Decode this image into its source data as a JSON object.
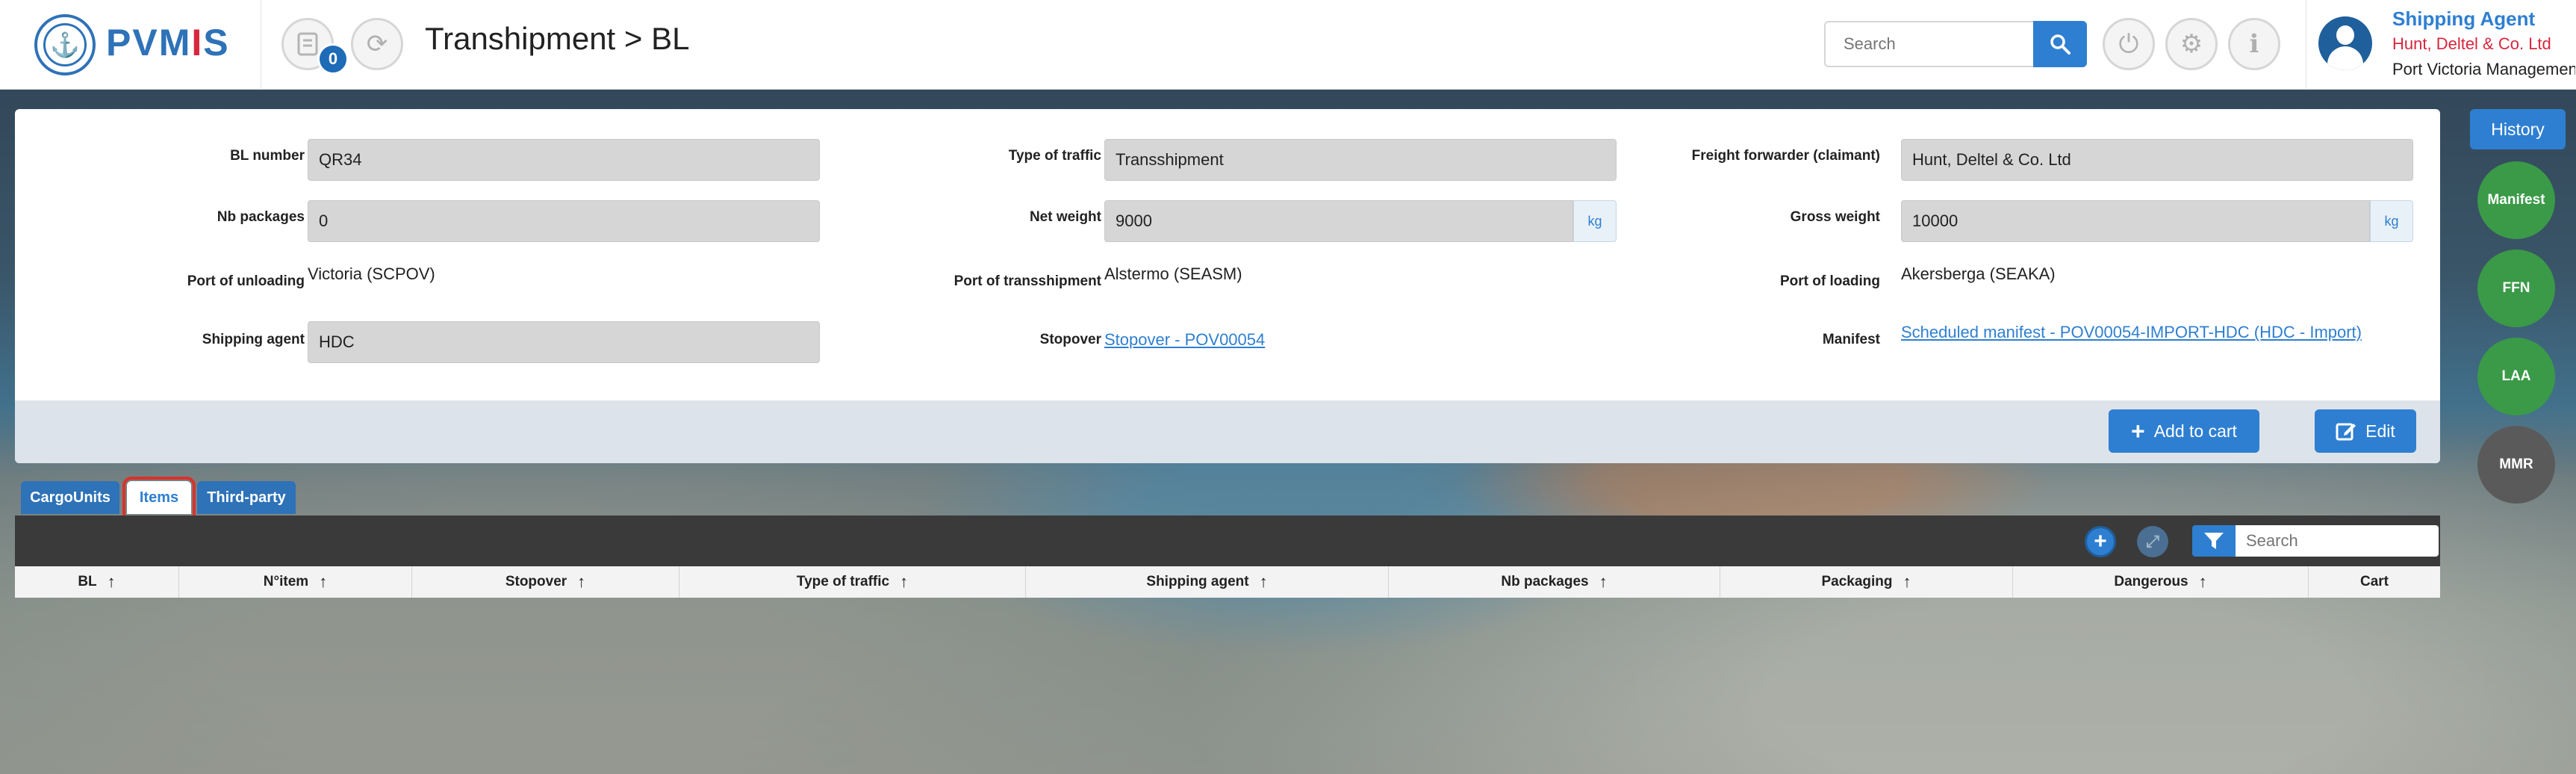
{
  "header": {
    "logo_text_a": "PVM",
    "logo_text_b": "I",
    "logo_text_c": "S",
    "cart_count": "0",
    "title": "Transhipment > BL",
    "search_placeholder": "Search",
    "user": {
      "role": "Shipping Agent",
      "company": "Hunt, Deltel & Co. Ltd",
      "port": "Port Victoria Management"
    }
  },
  "form": {
    "bl_number": {
      "label": "BL number",
      "value": "QR34"
    },
    "type_of_traffic": {
      "label": "Type of traffic",
      "value": "Transshipment"
    },
    "freight_forwarder": {
      "label": "Freight forwarder (claimant)",
      "value": "Hunt, Deltel & Co. Ltd"
    },
    "nb_packages": {
      "label": "Nb packages",
      "value": "0"
    },
    "net_weight": {
      "label": "Net weight",
      "value": "9000",
      "unit": "kg"
    },
    "gross_weight": {
      "label": "Gross weight",
      "value": "10000",
      "unit": "kg"
    },
    "port_of_unloading": {
      "label": "Port of unloading",
      "value": "Victoria (SCPOV)"
    },
    "port_of_transshipment": {
      "label": "Port of transshipment",
      "value": "Alstermo (SEASM)"
    },
    "port_of_loading": {
      "label": "Port of loading",
      "value": "Akersberga (SEAKA)"
    },
    "shipping_agent": {
      "label": "Shipping agent",
      "value": "HDC"
    },
    "stopover": {
      "label": "Stopover",
      "value": "Stopover - POV00054"
    },
    "manifest": {
      "label": "Manifest",
      "value": "Scheduled manifest - POV00054-IMPORT-HDC (HDC - Import)"
    }
  },
  "actions": {
    "add_to_cart": "Add to cart",
    "edit": "Edit"
  },
  "side": {
    "history": "History",
    "buttons": [
      "Manifest",
      "FFN",
      "LAA",
      "MMR"
    ]
  },
  "tabs": [
    "CargoUnits",
    "Items",
    "Third-party"
  ],
  "active_tab": "Items",
  "grid": {
    "search_placeholder": "Search",
    "columns": [
      "BL",
      "N°item",
      "Stopover",
      "Type of traffic",
      "Shipping agent",
      "Nb packages",
      "Packaging",
      "Dangerous",
      "Cart"
    ]
  },
  "colors": {
    "primary": "#2e7fd1",
    "accent_red": "#d7263d",
    "green": "#3a9a48",
    "toolbar": "#3a3a3a"
  }
}
